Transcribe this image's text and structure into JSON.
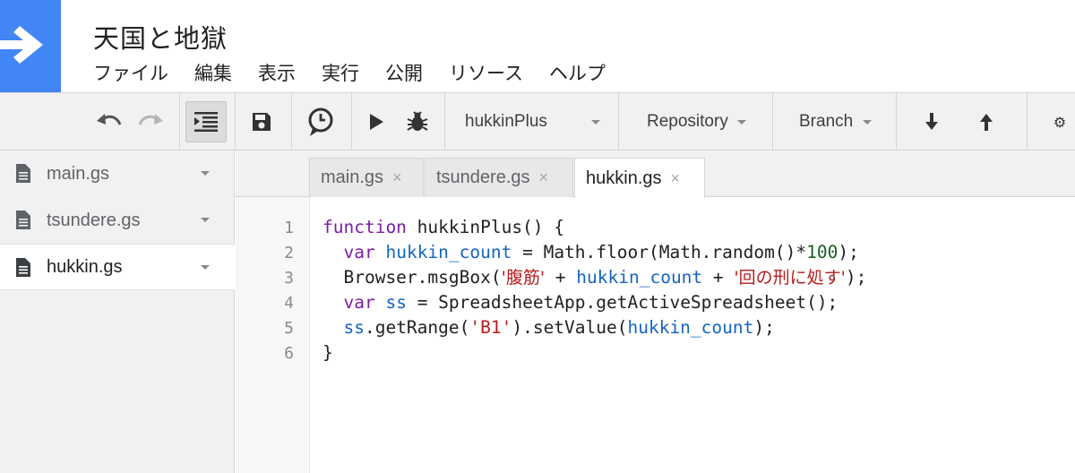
{
  "app": {
    "title": "天国と地獄",
    "menu": [
      "ファイル",
      "編集",
      "表示",
      "実行",
      "公開",
      "リソース",
      "ヘルプ"
    ]
  },
  "colors": {
    "brand": "#4285f4",
    "keyword": "#7b1fa2",
    "variable": "#1565c0",
    "string": "#b71c1c",
    "number": "#1b5e20"
  },
  "toolbar": {
    "icons": [
      "undo-icon",
      "redo-icon",
      "indent-icon",
      "save-icon",
      "trigger-clock-icon",
      "run-icon",
      "debug-icon",
      "download-icon",
      "upload-icon",
      "gear-icon"
    ],
    "function_select": "hukkinPlus",
    "repository_label": "Repository",
    "branch_label": "Branch",
    "settings_glyph": "⚙"
  },
  "sidebar": {
    "files": [
      {
        "name": "main.gs"
      },
      {
        "name": "tsundere.gs"
      },
      {
        "name": "hukkin.gs",
        "selected": true
      }
    ]
  },
  "editor": {
    "tabs": [
      {
        "name": "main.gs",
        "close": "×"
      },
      {
        "name": "tsundere.gs",
        "close": "×"
      },
      {
        "name": "hukkin.gs",
        "close": "×",
        "active": true
      }
    ],
    "line_numbers": [
      "1",
      "2",
      "3",
      "4",
      "5",
      "6"
    ],
    "code": {
      "l1": {
        "kw": "function",
        "rest": " hukkinPlus() {"
      },
      "l2": {
        "indent": "  ",
        "kw": "var",
        "sp": " ",
        "var": "hukkin_count",
        "mid": " = Math.floor(Math.random()*",
        "num": "100",
        "end": ");"
      },
      "l3": {
        "indent": "  ",
        "pre": "Browser.msgBox(",
        "s1": "'腹筋'",
        "plus1": " + ",
        "var": "hukkin_count",
        "plus2": " + ",
        "s2": "'回の刑に処す'",
        "end": ");"
      },
      "l4": {
        "indent": "  ",
        "kw": "var",
        "sp": " ",
        "var": "ss",
        "rest": " = SpreadsheetApp.getActiveSpreadsheet();"
      },
      "l5": {
        "indent": "  ",
        "var1": "ss",
        "mid": ".getRange(",
        "s1": "'B1'",
        "mid2": ").setValue(",
        "var2": "hukkin_count",
        "end": ");"
      },
      "l6": {
        "text": "}"
      }
    }
  }
}
